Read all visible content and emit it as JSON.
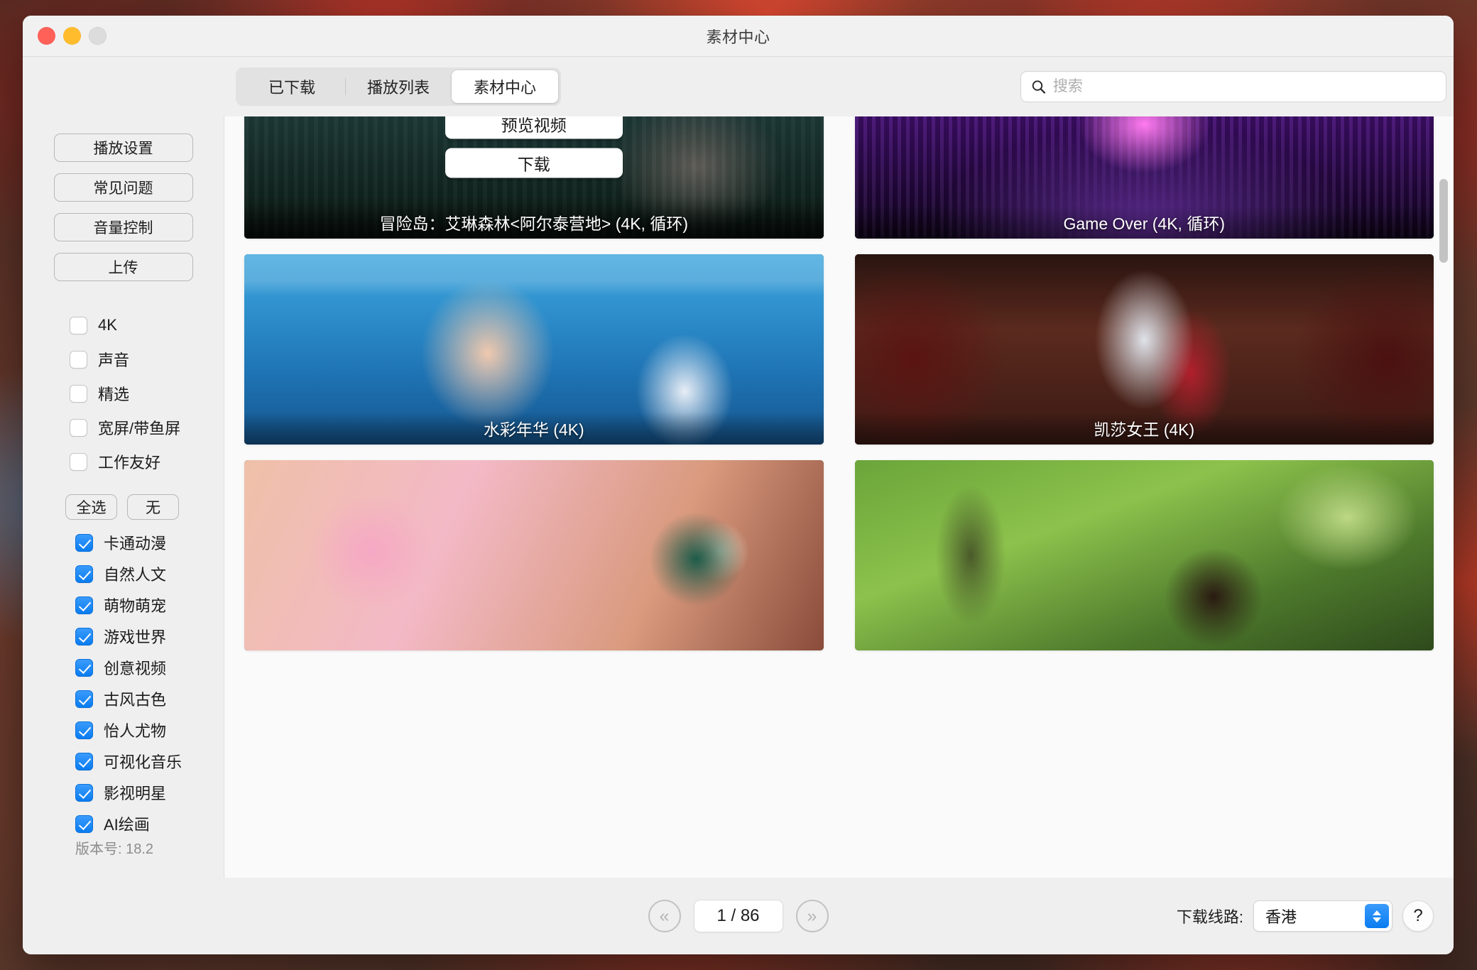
{
  "window": {
    "title": "素材中心",
    "traffic_lights": [
      "close-button",
      "minimize-button",
      "zoom-button"
    ]
  },
  "toolbar": {
    "tabs": [
      {
        "label": "已下载",
        "active": false
      },
      {
        "label": "播放列表",
        "active": false
      },
      {
        "label": "素材中心",
        "active": true
      }
    ],
    "search": {
      "placeholder": "搜索",
      "value": "",
      "icon": "search-icon"
    }
  },
  "sidebar": {
    "buttons": [
      {
        "label": "播放设置"
      },
      {
        "label": "常见问题"
      },
      {
        "label": "音量控制"
      },
      {
        "label": "上传"
      }
    ],
    "filters": [
      {
        "label": "4K",
        "checked": false
      },
      {
        "label": "声音",
        "checked": false
      },
      {
        "label": "精选",
        "checked": false
      },
      {
        "label": "宽屏/带鱼屏",
        "checked": false
      },
      {
        "label": "工作友好",
        "checked": false
      }
    ],
    "selection_buttons": [
      {
        "label": "全选"
      },
      {
        "label": "无"
      }
    ],
    "categories": [
      {
        "label": "卡通动漫",
        "checked": true
      },
      {
        "label": "自然人文",
        "checked": true
      },
      {
        "label": "萌物萌宠",
        "checked": true
      },
      {
        "label": "游戏世界",
        "checked": true
      },
      {
        "label": "创意视频",
        "checked": true
      },
      {
        "label": "古风古色",
        "checked": true
      },
      {
        "label": "怡人尤物",
        "checked": true
      },
      {
        "label": "可视化音乐",
        "checked": true
      },
      {
        "label": "影视明星",
        "checked": true
      },
      {
        "label": "AI绘画",
        "checked": true
      }
    ],
    "version": "版本号: 18.2"
  },
  "main": {
    "hover_actions": {
      "preview_label": "预览视频",
      "download_label": "下载"
    },
    "cards": [
      {
        "title": "冒险岛：艾琳森林<阿尔泰营地> (4K, 循环)",
        "art": "art-forest",
        "hovered": true
      },
      {
        "title": "Game Over (4K, 循环)",
        "art": "art-gameover",
        "hovered": false
      },
      {
        "title": "水彩年华 (4K)",
        "art": "art-water",
        "hovered": false
      },
      {
        "title": "凯莎女王 (4K)",
        "art": "art-queen",
        "hovered": false
      },
      {
        "title": "",
        "art": "art-pink",
        "hovered": false
      },
      {
        "title": "",
        "art": "art-squirrel",
        "hovered": false
      }
    ]
  },
  "bottom": {
    "prev_label": "«",
    "next_label": "»",
    "page_indicator": "1 / 86",
    "route_label": "下载线路:",
    "route_value": "香港",
    "help_label": "?"
  },
  "colors": {
    "accent": "#0a7cf0",
    "window_bg": "#ececec",
    "content_bg": "#fafafa"
  }
}
